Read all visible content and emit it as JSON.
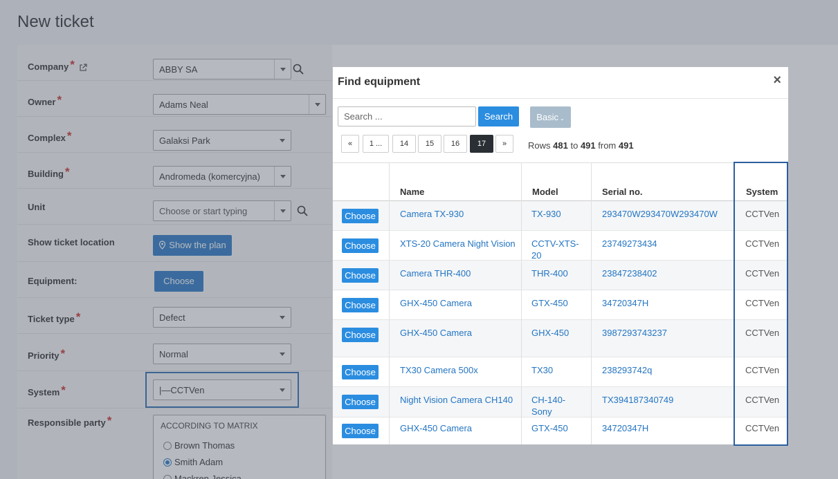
{
  "page": {
    "title": "New ticket"
  },
  "form": {
    "company": {
      "label": "Company",
      "value": "ABBY SA"
    },
    "owner": {
      "label": "Owner",
      "value": "Adams Neal"
    },
    "complex": {
      "label": "Complex",
      "value": "Galaksi Park"
    },
    "building": {
      "label": "Building",
      "value": "Andromeda (komercyjna)"
    },
    "unit": {
      "label": "Unit",
      "placeholder": "Choose or start typing"
    },
    "location": {
      "label": "Show ticket location",
      "button": "Show the plan"
    },
    "equipment": {
      "label": "Equipment:",
      "button": "Choose"
    },
    "ticket_type": {
      "label": "Ticket type",
      "value": "Defect"
    },
    "priority": {
      "label": "Priority",
      "value": "Normal"
    },
    "system": {
      "label": "System",
      "value": "|—CCTVen"
    },
    "responsible": {
      "label": "Responsible party",
      "header": "ACCORDING TO MATRIX",
      "options": [
        "Brown Thomas",
        "Smith Adam",
        "Mackren Jessica"
      ],
      "selected": "Smith Adam"
    },
    "required_mark": "*"
  },
  "modal": {
    "title": "Find equipment",
    "close": "×",
    "search_placeholder": "Search ...",
    "search_button": "Search",
    "basic_button": "Basic",
    "pager": [
      "«",
      "1 ...",
      "14",
      "15",
      "16",
      "17",
      "»"
    ],
    "pager_active": "17",
    "rows_info": {
      "prefix": "Rows",
      "from_row": "481",
      "to_word": "to",
      "to_row": "491",
      "from_word": "from",
      "total": "491"
    },
    "columns": [
      "Name",
      "Model",
      "Serial no.",
      "System"
    ],
    "choose_label": "Choose",
    "rows": [
      {
        "name": "Camera TX-930",
        "model": "TX-930",
        "serial": "293470W293470W293470W",
        "system": "CCTVen"
      },
      {
        "name": "XTS-20 Camera Night Vision",
        "model": "CCTV-XTS-20",
        "serial": "23749273434",
        "system": "CCTVen"
      },
      {
        "name": "Camera THR-400",
        "model": "THR-400",
        "serial": "23847238402",
        "system": "CCTVen"
      },
      {
        "name": "GHX-450 Camera",
        "model": "GTX-450",
        "serial": "34720347H",
        "system": "CCTVen"
      },
      {
        "name": "GHX-450 Camera",
        "model": "GHX-450",
        "serial": "3987293743237",
        "system": "CCTVen"
      },
      {
        "name": "TX30 Camera 500x",
        "model": "TX30",
        "serial": "238293742q",
        "system": "CCTVen"
      },
      {
        "name": "Night Vision Camera CH140",
        "model": "CH-140-\nSony",
        "serial": "TX394187340749",
        "system": "CCTVen"
      },
      {
        "name": "GHX-450 Camera",
        "model": "GTX-450",
        "serial": "34720347H",
        "system": "CCTVen"
      }
    ]
  }
}
